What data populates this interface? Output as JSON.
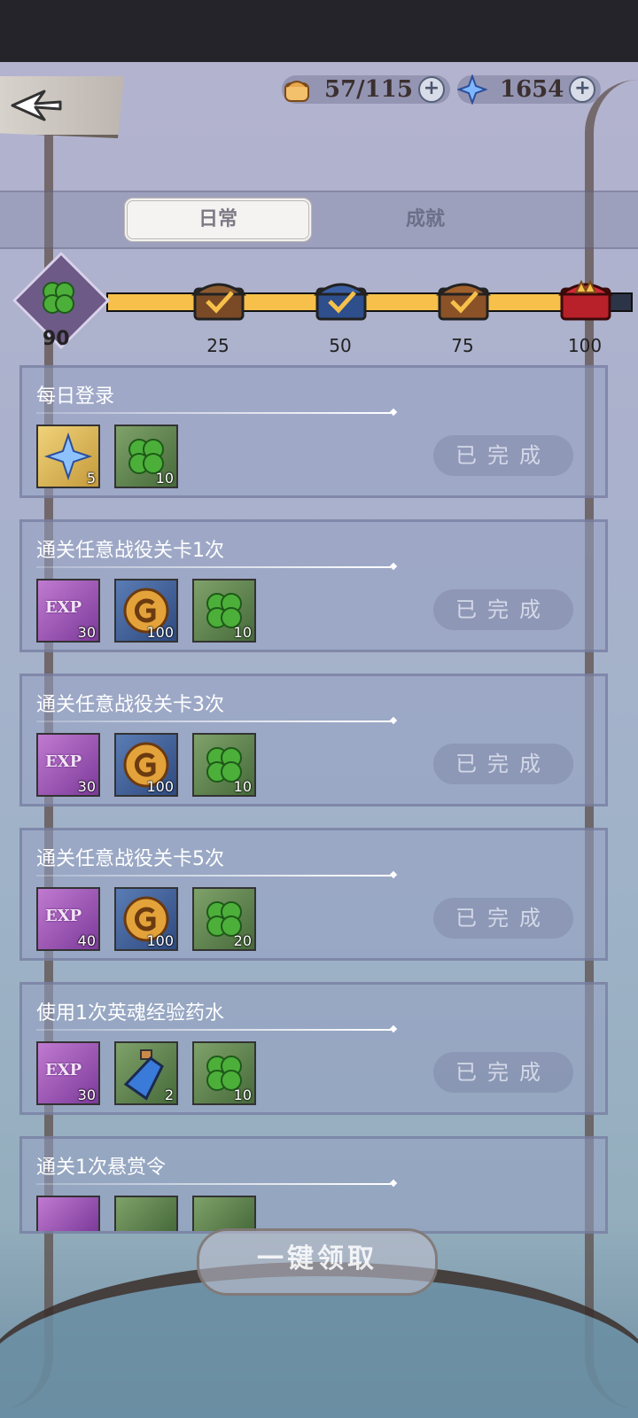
{
  "header": {
    "stamina": "57/115",
    "gems": "1654"
  },
  "tabs": {
    "daily": "日常",
    "achievement": "成就"
  },
  "progress": {
    "score": "90",
    "fill_fraction": 0.9,
    "milestones": [
      "25",
      "50",
      "75",
      "100"
    ]
  },
  "quests": [
    {
      "title": "每日登录",
      "rewards": [
        {
          "icon": "star-gem-icon",
          "count": "5"
        },
        {
          "icon": "clover-icon",
          "count": "10"
        }
      ],
      "status": "已完成"
    },
    {
      "title": "通关任意战役关卡1次",
      "rewards": [
        {
          "icon": "exp-icon",
          "count": "30"
        },
        {
          "icon": "gold-coin-icon",
          "count": "100"
        },
        {
          "icon": "clover-icon",
          "count": "10"
        }
      ],
      "status": "已完成"
    },
    {
      "title": "通关任意战役关卡3次",
      "rewards": [
        {
          "icon": "exp-icon",
          "count": "30"
        },
        {
          "icon": "gold-coin-icon",
          "count": "100"
        },
        {
          "icon": "clover-icon",
          "count": "10"
        }
      ],
      "status": "已完成"
    },
    {
      "title": "通关任意战役关卡5次",
      "rewards": [
        {
          "icon": "exp-icon",
          "count": "40"
        },
        {
          "icon": "gold-coin-icon",
          "count": "100"
        },
        {
          "icon": "clover-icon",
          "count": "20"
        }
      ],
      "status": "已完成"
    },
    {
      "title": "使用1次英魂经验药水",
      "rewards": [
        {
          "icon": "exp-icon",
          "count": "30"
        },
        {
          "icon": "potion-icon",
          "count": "2"
        },
        {
          "icon": "clover-icon",
          "count": "10"
        }
      ],
      "status": "已完成"
    },
    {
      "title": "通关1次悬赏令"
    }
  ],
  "exp_label": "EXP",
  "claim_all_label": "一键领取"
}
